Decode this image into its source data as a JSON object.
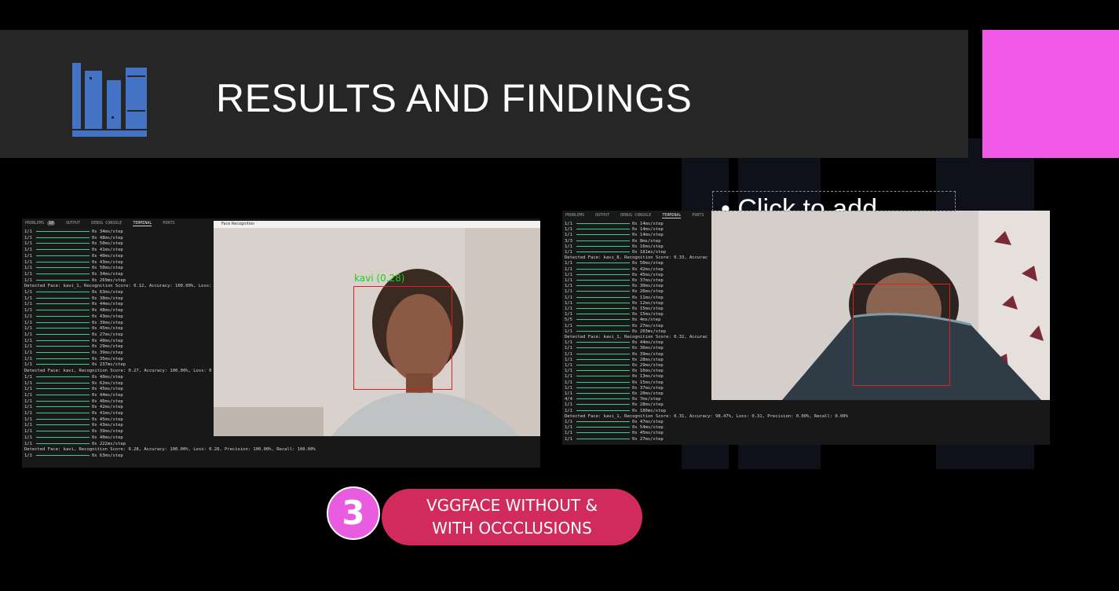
{
  "slide": {
    "title": "RESULTS AND FINDINGS",
    "placeholder": "• Click to add",
    "badge_number": "3",
    "badge_line1": "VGGFACE WITHOUT &",
    "badge_line2": "WITH OCCCLUSIONS"
  },
  "colors": {
    "background": "#000000",
    "title_bar": "#262626",
    "accent_square": "#f05ae6",
    "logo_blue": "#4472c4",
    "badge_circle": "#e85de0",
    "badge_pill": "#d02b5b",
    "progress_bar": "#2fd28f"
  },
  "left_screenshot": {
    "tabs": [
      "PROBLEMS",
      "OUTPUT",
      "DEBUG CONSOLE",
      "TERMINAL",
      "PORTS"
    ],
    "problems_count": "10",
    "window_title": "Face Recognition",
    "face_label": "kavi (0.28)",
    "lines": [
      {
        "step": "1/1",
        "time": "0s 34ms/step"
      },
      {
        "step": "1/1",
        "time": "0s 48ms/step"
      },
      {
        "step": "1/1",
        "time": "0s 50ms/step"
      },
      {
        "step": "1/1",
        "time": "0s 41ms/step"
      },
      {
        "step": "1/1",
        "time": "0s 40ms/step"
      },
      {
        "step": "1/1",
        "time": "0s 43ms/step"
      },
      {
        "step": "1/1",
        "time": "0s 50ms/step"
      },
      {
        "step": "1/1",
        "time": "0s 34ms/step"
      },
      {
        "step": "1/1",
        "time": "0s 269ms/step"
      },
      {
        "text": "Detected Face: kavi_1, Recognition Score: 0.12, Accuracy: 100.00%, Loss:"
      },
      {
        "step": "1/1",
        "time": "0s 63ms/step"
      },
      {
        "step": "1/1",
        "time": "0s 38ms/step"
      },
      {
        "step": "1/1",
        "time": "0s 44ms/step"
      },
      {
        "step": "1/1",
        "time": "0s 48ms/step"
      },
      {
        "step": "1/1",
        "time": "0s 43ms/step"
      },
      {
        "step": "1/1",
        "time": "0s 39ms/step"
      },
      {
        "step": "1/1",
        "time": "0s 45ms/step"
      },
      {
        "step": "1/1",
        "time": "0s 27ms/step"
      },
      {
        "step": "1/1",
        "time": "0s 40ms/step"
      },
      {
        "step": "1/1",
        "time": "0s 29ms/step"
      },
      {
        "step": "1/1",
        "time": "0s 39ms/step"
      },
      {
        "step": "1/1",
        "time": "0s 35ms/step"
      },
      {
        "step": "1/1",
        "time": "0s 237ms/step"
      },
      {
        "text": "Detected Face: kavi, Recognition Score: 0.27, Accuracy: 100.00%, Loss: 0"
      },
      {
        "step": "1/1",
        "time": "0s 40ms/step"
      },
      {
        "step": "1/1",
        "time": "0s 62ms/step"
      },
      {
        "step": "1/1",
        "time": "0s 45ms/step"
      },
      {
        "step": "1/1",
        "time": "0s 44ms/step"
      },
      {
        "step": "1/1",
        "time": "0s 46ms/step"
      },
      {
        "step": "1/1",
        "time": "0s 42ms/step"
      },
      {
        "step": "1/1",
        "time": "0s 41ms/step"
      },
      {
        "step": "1/1",
        "time": "0s 45ms/step"
      },
      {
        "step": "1/1",
        "time": "0s 43ms/step"
      },
      {
        "step": "1/1",
        "time": "0s 39ms/step"
      },
      {
        "step": "1/1",
        "time": "0s 40ms/step"
      },
      {
        "step": "1/1",
        "time": "0s 222ms/step"
      },
      {
        "text": "Detected Face: kavi, Recognition Score: 0.28, Accuracy: 100.00%, Loss: 0.28, Precision: 100.00%, Recall: 100.00%"
      },
      {
        "step": "1/1",
        "time": "0s 63ms/step"
      }
    ]
  },
  "right_screenshot": {
    "tabs": [
      "PROBLEMS",
      "OUTPUT",
      "DEBUG CONSOLE",
      "TERMINAL",
      "PORTS"
    ],
    "lines": [
      {
        "step": "1/1",
        "time": "0s 14ms/step"
      },
      {
        "step": "1/1",
        "time": "0s 14ms/step"
      },
      {
        "step": "1/1",
        "time": "0s 14ms/step"
      },
      {
        "step": "3/3",
        "time": "0s 8ms/step"
      },
      {
        "step": "1/1",
        "time": "0s 16ms/step"
      },
      {
        "step": "1/1",
        "time": "0s 181ms/step"
      },
      {
        "text": "Detected Face: kavi_8, Recognition Score: 0.33, Accurac"
      },
      {
        "step": "1/1",
        "time": "0s 50ms/step"
      },
      {
        "step": "1/1",
        "time": "0s 42ms/step"
      },
      {
        "step": "1/1",
        "time": "0s 45ms/step"
      },
      {
        "step": "1/1",
        "time": "0s 37ms/step"
      },
      {
        "step": "1/1",
        "time": "0s 30ms/step"
      },
      {
        "step": "1/1",
        "time": "0s 26ms/step"
      },
      {
        "step": "1/1",
        "time": "0s 11ms/step"
      },
      {
        "step": "1/1",
        "time": "0s 12ms/step"
      },
      {
        "step": "1/1",
        "time": "0s 15ms/step"
      },
      {
        "step": "1/1",
        "time": "0s 15ms/step"
      },
      {
        "step": "5/5",
        "time": "0s 4ms/step"
      },
      {
        "step": "1/1",
        "time": "0s 27ms/step"
      },
      {
        "step": "1/1",
        "time": "0s 203ms/step"
      },
      {
        "text": "Detected Face: kavi_1, Recognition Score: 0.32, Accurac"
      },
      {
        "step": "1/1",
        "time": "0s 44ms/step"
      },
      {
        "step": "1/1",
        "time": "0s 36ms/step"
      },
      {
        "step": "1/1",
        "time": "0s 39ms/step"
      },
      {
        "step": "1/1",
        "time": "0s 28ms/step"
      },
      {
        "step": "1/1",
        "time": "0s 29ms/step"
      },
      {
        "step": "1/1",
        "time": "0s 16ms/step"
      },
      {
        "step": "1/1",
        "time": "0s 13ms/step"
      },
      {
        "step": "1/1",
        "time": "0s 15ms/step"
      },
      {
        "step": "1/1",
        "time": "0s 37ms/step"
      },
      {
        "step": "1/1",
        "time": "0s 20ms/step"
      },
      {
        "step": "4/4",
        "time": "0s 7ms/step"
      },
      {
        "step": "1/1",
        "time": "0s 28ms/step"
      },
      {
        "step": "1/1",
        "time": "0s 180ms/step"
      },
      {
        "text": "Detected Face: kavi_1, Recognition Score: 0.31, Accuracy: 98.47%, Loss: 0.31, Precision: 0.00%, Recall: 0.00%"
      },
      {
        "step": "1/1",
        "time": "0s 47ms/step"
      },
      {
        "step": "1/1",
        "time": "0s 54ms/step"
      },
      {
        "step": "1/1",
        "time": "0s 45ms/step"
      },
      {
        "step": "1/1",
        "time": "0s 27ms/step"
      }
    ]
  }
}
